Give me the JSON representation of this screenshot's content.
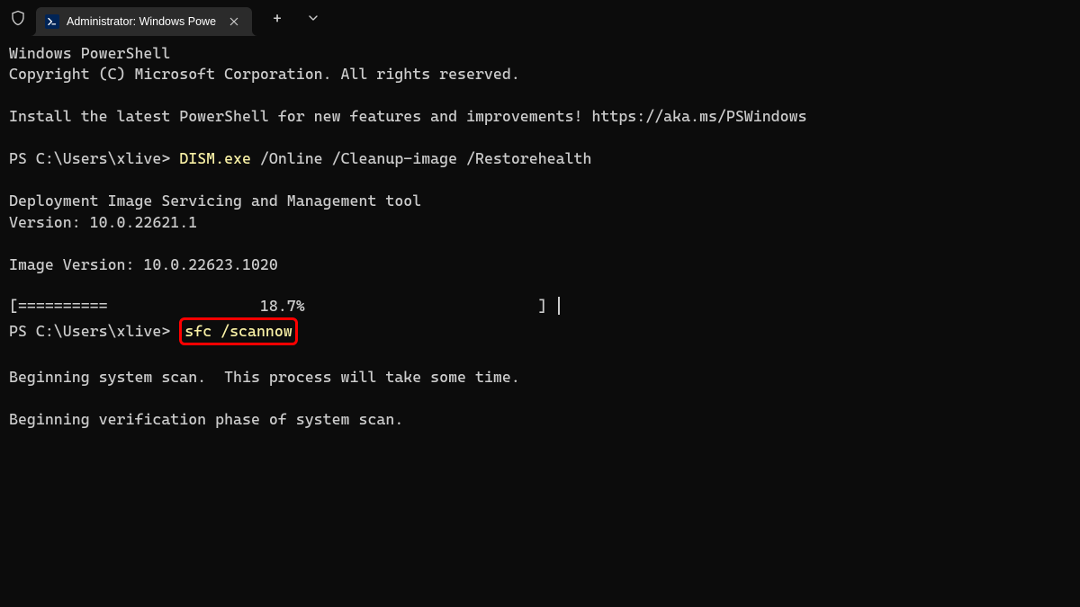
{
  "titlebar": {
    "tab_title": "Administrator: Windows Powe",
    "ps_icon_text": ">_",
    "close_glyph": "✕",
    "new_tab_glyph": "+",
    "dropdown_glyph": "⌄"
  },
  "terminal": {
    "lines": [
      {
        "type": "text",
        "content": "Windows PowerShell"
      },
      {
        "type": "text",
        "content": "Copyright (C) Microsoft Corporation. All rights reserved."
      },
      {
        "type": "blank"
      },
      {
        "type": "text",
        "content": "Install the latest PowerShell for new features and improvements! https://aka.ms/PSWindows"
      },
      {
        "type": "blank"
      },
      {
        "type": "prompt",
        "prompt": "PS C:\\Users\\xlive> ",
        "cmd": "DISM.exe",
        "args": " /Online /Cleanup-image /Restorehealth"
      },
      {
        "type": "blank"
      },
      {
        "type": "text",
        "content": "Deployment Image Servicing and Management tool"
      },
      {
        "type": "text",
        "content": "Version: 10.0.22621.1"
      },
      {
        "type": "blank"
      },
      {
        "type": "text",
        "content": "Image Version: 10.0.22623.1020"
      },
      {
        "type": "blank"
      },
      {
        "type": "progress",
        "content": "[==========                 18.7%                          ] "
      },
      {
        "type": "prompt_highlight",
        "prompt": "PS C:\\Users\\xlive> ",
        "cmd": "sfc /scannow"
      },
      {
        "type": "blank"
      },
      {
        "type": "text",
        "content": "Beginning system scan.  This process will take some time."
      },
      {
        "type": "blank"
      },
      {
        "type": "text",
        "content": "Beginning verification phase of system scan."
      }
    ]
  }
}
